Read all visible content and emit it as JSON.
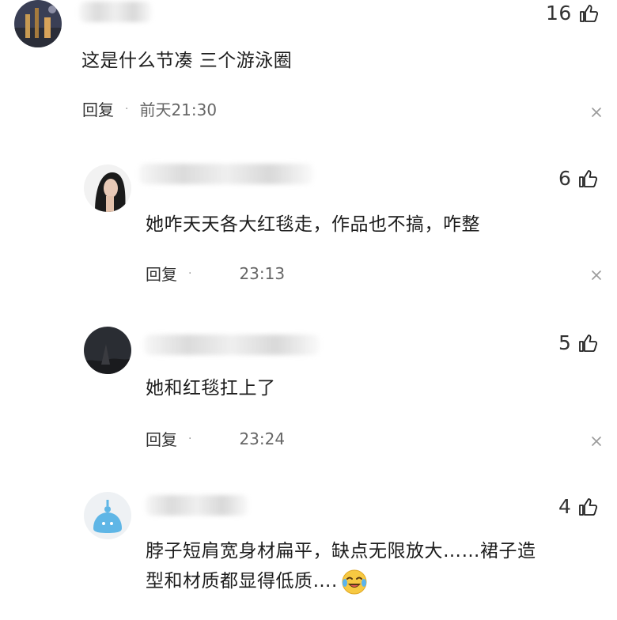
{
  "comments": [
    {
      "likes": "16",
      "text": "这是什么节凑 三个游泳圈",
      "reply_label": "回复",
      "dot": "·",
      "time": "前天21:30"
    },
    {
      "likes": "6",
      "text": "她咋天天各大红毯走，作品也不搞，咋整",
      "reply_label": "回复",
      "dot": "·",
      "time": "23:13"
    },
    {
      "likes": "5",
      "text": "她和红毯扛上了",
      "reply_label": "回复",
      "dot": "·",
      "time": "23:24"
    },
    {
      "likes": "4",
      "text_line1": "脖子短肩宽身材扁平，缺点无限放大……裙子造",
      "text_line2": "型和材质都显得低质….",
      "emoji": "crying-laughing-emoji"
    }
  ],
  "icons": {
    "like": "thumbs-up-icon",
    "close": "close-icon"
  }
}
